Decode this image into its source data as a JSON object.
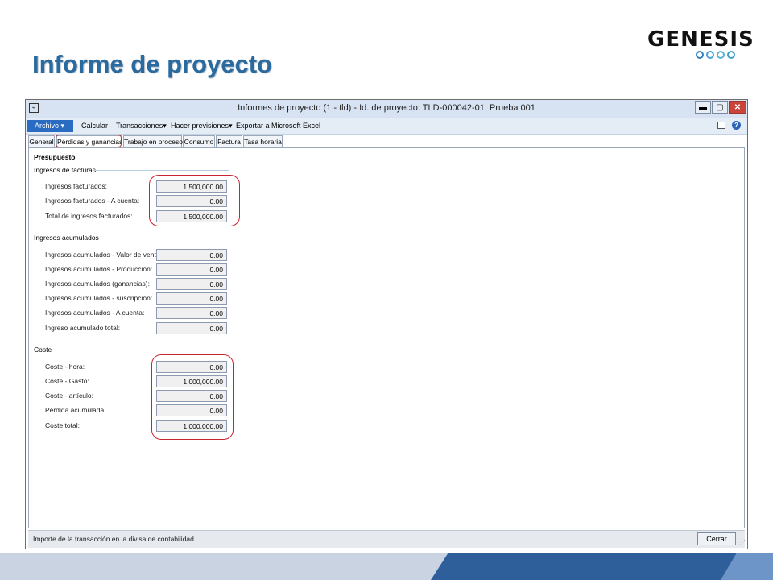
{
  "slide": {
    "title": "Informe de proyecto",
    "logo_text": "GENESIS"
  },
  "window": {
    "title": "Informes de proyecto (1 - tld) - Id. de proyecto: TLD-000042-01, Prueba 001",
    "controls": {
      "minimize": "▬",
      "maximize": "▢",
      "close": "✕"
    }
  },
  "menu": {
    "archivo": "Archivo",
    "items": [
      "Calcular",
      "Transacciones",
      "Hacer previsiones",
      "Exportar a Microsoft Excel"
    ]
  },
  "tabs": [
    "General",
    "Pérdidas y ganancias",
    "Trabajo en proceso",
    "Consumo",
    "Factura",
    "Tasa horaria"
  ],
  "active_tab": "Pérdidas y ganancias",
  "section_title": "Presupuesto",
  "groups": {
    "ingresos_facturas": {
      "title": "Ingresos de facturas",
      "fields": [
        {
          "label": "Ingresos facturados:",
          "value": "1,500,000.00"
        },
        {
          "label": "Ingresos facturados - A cuenta:",
          "value": "0.00"
        },
        {
          "label": "Total de ingresos facturados:",
          "value": "1,500,000.00"
        }
      ]
    },
    "ingresos_acumulados": {
      "title": "Ingresos acumulados",
      "fields": [
        {
          "label": "Ingresos acumulados - Valor de ventas:",
          "value": "0.00"
        },
        {
          "label": "Ingresos acumulados - Producción:",
          "value": "0.00"
        },
        {
          "label": "Ingresos acumulados (ganancias):",
          "value": "0.00"
        },
        {
          "label": "Ingresos acumulados - suscripción:",
          "value": "0.00"
        },
        {
          "label": "Ingresos acumulados - A cuenta:",
          "value": "0.00"
        },
        {
          "label": "Ingreso acumulado total:",
          "value": "0.00"
        }
      ]
    },
    "coste": {
      "title": "Coste",
      "fields": [
        {
          "label": "Coste - hora:",
          "value": "0.00"
        },
        {
          "label": "Coste - Gasto:",
          "value": "1,000,000.00"
        },
        {
          "label": "Coste - artículo:",
          "value": "0.00"
        },
        {
          "label": "Pérdida acumulada:",
          "value": "0.00"
        },
        {
          "label": "Coste total:",
          "value": "1,000,000.00"
        }
      ]
    }
  },
  "status": {
    "text": "Importe de la transacción en la divisa de contabilidad",
    "close_button": "Cerrar"
  },
  "colors": {
    "title": "#2a6a9e",
    "highlight": "#c8262f",
    "archivo": "#2a6cc2"
  }
}
